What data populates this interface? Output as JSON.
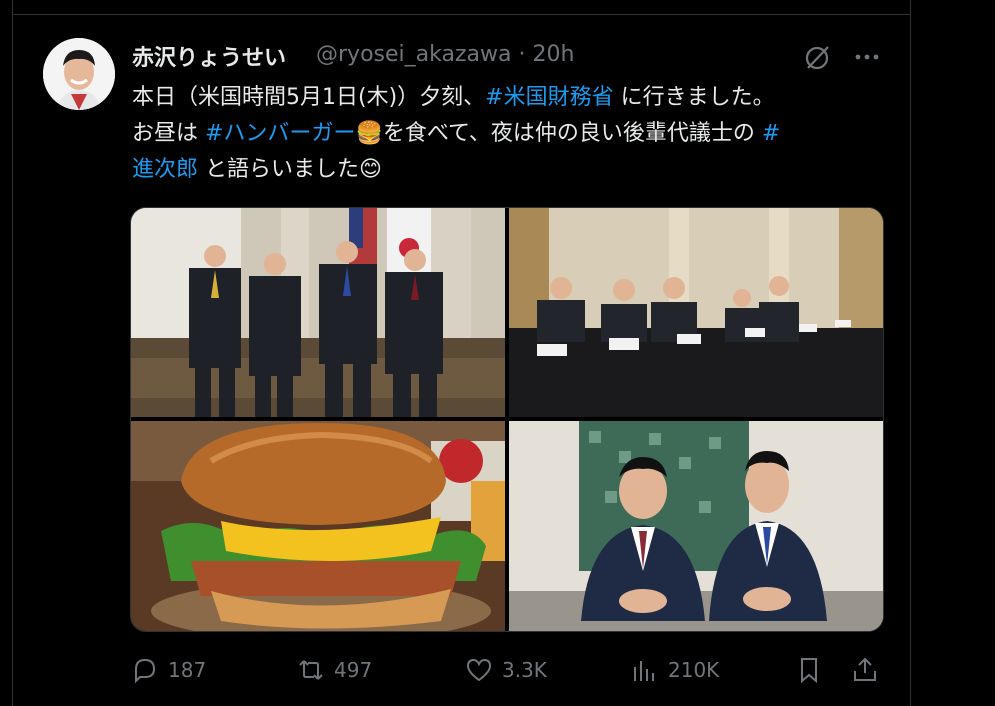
{
  "author": {
    "display_name": "赤沢りょうせい",
    "handle": "@ryosei_akazawa",
    "time": "· 20h"
  },
  "tweet": {
    "line1_a": "本日（米国時間5月1日(木)）夕刻、",
    "line1_hashtag": "#米国財務省",
    "line1_b": " に行きました。",
    "line2_a": "お昼は ",
    "line2_hashtag": "#ハンバーガー",
    "line2_emoji": "🍔",
    "line2_b": "を食べて、夜は仲の良い後輩代議士の ",
    "line2_hash_mark": "#",
    "line3_hashtag": "進次郎",
    "line3_b": " と語らいました",
    "line3_emoji": "😊"
  },
  "media": {
    "photos": [
      "meeting-handshake-photo",
      "press-conference-photo",
      "hamburger-photo",
      "two-men-seated-photo"
    ]
  },
  "actions": {
    "replies": "187",
    "reposts": "497",
    "likes": "3.3K",
    "views": "210K"
  },
  "colors": {
    "background": "#000000",
    "text": "#e7e9ea",
    "muted": "#71767b",
    "accent": "#1d9bf0",
    "border": "#2f3336"
  },
  "icons": [
    "grok-icon",
    "more-icon",
    "reply-icon",
    "repost-icon",
    "like-icon",
    "views-icon",
    "bookmark-icon",
    "share-icon"
  ]
}
